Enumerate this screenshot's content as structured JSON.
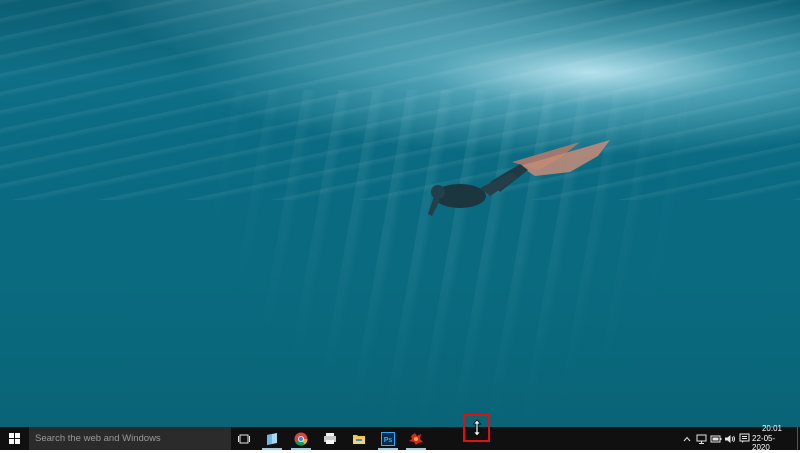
{
  "search": {
    "placeholder": "Search the web and Windows"
  },
  "taskbar": {
    "pinned": [
      {
        "name": "task-view-icon",
        "running": false
      },
      {
        "name": "windows-explorer-icon",
        "running": true
      },
      {
        "name": "chrome-icon",
        "running": true
      },
      {
        "name": "printer-app-icon",
        "running": false
      },
      {
        "name": "file-explorer-icon",
        "running": false
      },
      {
        "name": "photoshop-icon",
        "label": "Ps",
        "running": true
      },
      {
        "name": "red-app-icon",
        "running": true
      }
    ]
  },
  "tray": {
    "icons": [
      "chevron-up-icon",
      "network-icon",
      "battery-icon",
      "volume-icon",
      "notification-icon"
    ],
    "time": "20:01",
    "date": "22-05-2020"
  },
  "colors": {
    "taskbar": "#101010",
    "search_bg": "#2b2b2b",
    "highlight": "#e01010",
    "water": "#0a6a80"
  }
}
